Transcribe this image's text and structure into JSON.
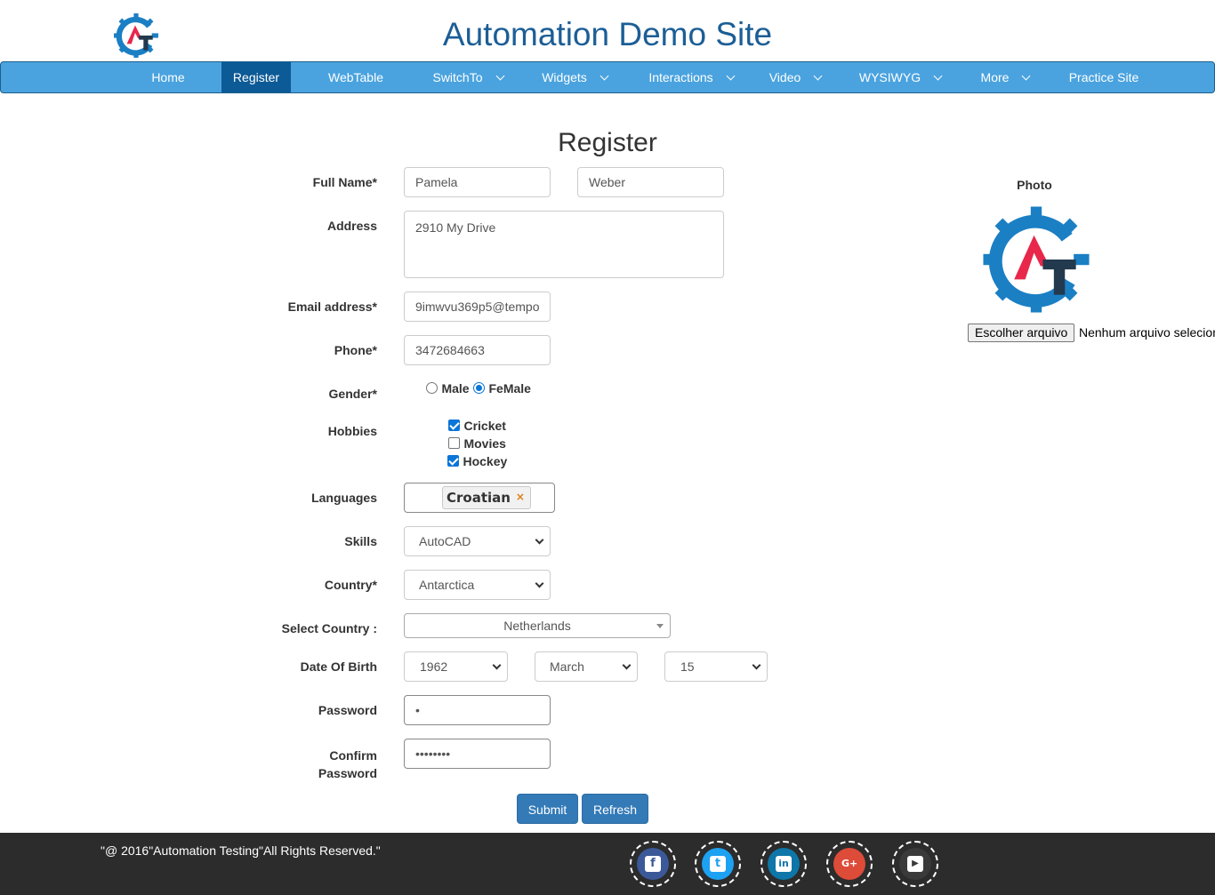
{
  "header": {
    "title": "Automation Demo Site"
  },
  "nav": {
    "items": [
      {
        "label": "Home"
      },
      {
        "label": "Register",
        "active": true
      },
      {
        "label": "WebTable"
      },
      {
        "label": "SwitchTo",
        "dropdown": true
      },
      {
        "label": "Widgets",
        "dropdown": true
      },
      {
        "label": "Interactions",
        "dropdown": true
      },
      {
        "label": "Video",
        "dropdown": true
      },
      {
        "label": "WYSIWYG",
        "dropdown": true
      },
      {
        "label": "More",
        "dropdown": true
      },
      {
        "label": "Practice Site"
      }
    ]
  },
  "form": {
    "heading": "Register",
    "full_name_label": "Full Name*",
    "first_name": "Pamela",
    "last_name": "Weber",
    "address_label": "Address",
    "address": "2910 My Drive",
    "email_label": "Email address*",
    "email": "9imwvu369p5@tempo",
    "phone_label": "Phone*",
    "phone": "3472684663",
    "gender_label": "Gender*",
    "gender_male": "Male",
    "gender_female": "FeMale",
    "hobbies_label": "Hobbies",
    "hobby_cricket": "Cricket",
    "hobby_movies": "Movies",
    "hobby_hockey": "Hockey",
    "languages_label": "Languages",
    "language_tag": "Croatian",
    "language_remove": "×",
    "skills_label": "Skills",
    "skills_value": "AutoCAD",
    "country_label": "Country*",
    "country_value": "Antarctica",
    "select_country_label": "Select Country :",
    "select_country_value": "Netherlands",
    "dob_label": "Date Of Birth",
    "dob_year": "1962",
    "dob_month": "March",
    "dob_day": "15",
    "password_label": "Password",
    "password_mask": "•",
    "confirm_label_1": "Confirm",
    "confirm_label_2": "Password",
    "confirm_mask": "••••••••",
    "submit_label": "Submit",
    "refresh_label": "Refresh"
  },
  "photo": {
    "label": "Photo",
    "choose_button": "Escolher arquivo",
    "no_file_text": "Nenhum arquivo selecionado"
  },
  "footer": {
    "text": "\"@ 2016\"Automation Testing\"All Rights Reserved.\"",
    "social": [
      {
        "name": "facebook",
        "color": "#3b5998",
        "glyph": "f"
      },
      {
        "name": "twitter",
        "color": "#1da1f2",
        "glyph": "t"
      },
      {
        "name": "linkedin",
        "color": "#0e76a8",
        "glyph": "in"
      },
      {
        "name": "google-plus",
        "color": "#dd4b39",
        "glyph": "G+"
      },
      {
        "name": "youtube",
        "color": "#3a3a3a",
        "glyph": "▶"
      }
    ]
  },
  "colors": {
    "brand_blue": "#1c5e96",
    "nav_bg": "#4aa3df",
    "nav_active": "#0c5a96",
    "button_blue": "#337ab7",
    "logo_red": "#e8274b",
    "logo_dark": "#23394d",
    "footer_bg": "#2c2c2c"
  }
}
